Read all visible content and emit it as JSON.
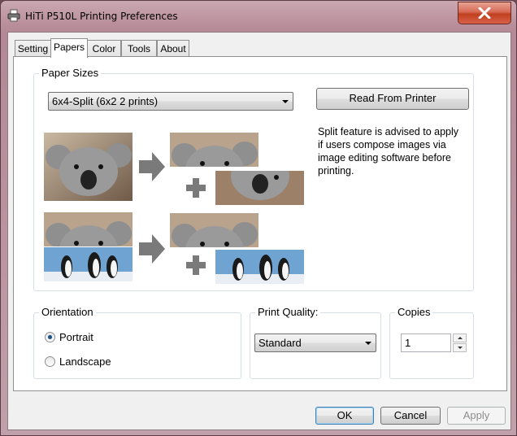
{
  "window": {
    "title": "HiTi P510L Printing Preferences"
  },
  "tabs": [
    {
      "label": "Setting"
    },
    {
      "label": "Papers"
    },
    {
      "label": "Color"
    },
    {
      "label": "Tools"
    },
    {
      "label": "About"
    }
  ],
  "paper_sizes": {
    "group_label": "Paper Sizes",
    "selected": "6x4-Split (6x2 2 prints)",
    "read_button": "Read From Printer",
    "info": "Split feature is advised to apply if users compose images via image editing software before printing."
  },
  "orientation": {
    "group_label": "Orientation",
    "options": [
      {
        "label": "Portrait",
        "checked": true
      },
      {
        "label": "Landscape",
        "checked": false
      }
    ]
  },
  "print_quality": {
    "group_label": "Print Quality:",
    "selected": "Standard"
  },
  "copies": {
    "group_label": "Copies",
    "value": "1"
  },
  "footer": {
    "ok": "OK",
    "cancel": "Cancel",
    "apply": "Apply"
  },
  "colors": {
    "close_red": "#c8452a",
    "accent_blue": "#3c7fb1"
  }
}
